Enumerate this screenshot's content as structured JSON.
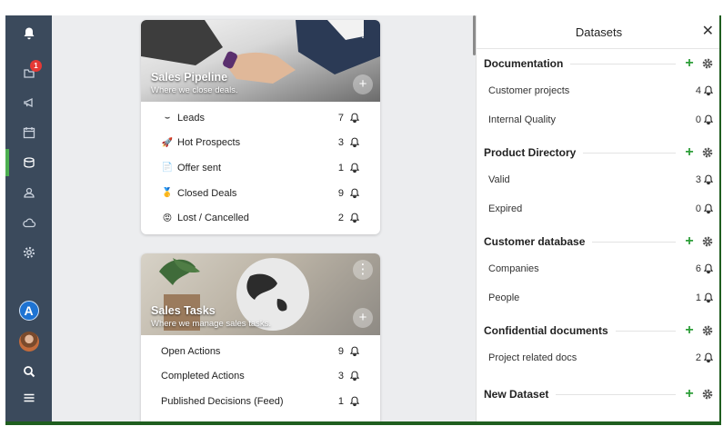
{
  "sidebar": {
    "notifications_badge": "1",
    "profile_initial": "A"
  },
  "cards": [
    {
      "title": "Sales Pipeline",
      "subtitle": "Where we close deals.",
      "rows": [
        {
          "emoji": "⌣",
          "label": "Leads",
          "count": "7"
        },
        {
          "emoji": "🚀",
          "label": "Hot Prospects",
          "count": "3"
        },
        {
          "emoji": "📄",
          "label": "Offer sent",
          "count": "1"
        },
        {
          "emoji": "🥇",
          "label": "Closed Deals",
          "count": "9"
        },
        {
          "emoji": "😡",
          "label": "Lost / Cancelled",
          "count": "2"
        }
      ]
    },
    {
      "title": "Sales Tasks",
      "subtitle": "Where we manage sales tasks.",
      "rows": [
        {
          "emoji": "",
          "label": "Open Actions",
          "count": "9"
        },
        {
          "emoji": "",
          "label": "Completed Actions",
          "count": "3"
        },
        {
          "emoji": "",
          "label": "Published Decisions (Feed)",
          "count": "1"
        }
      ]
    }
  ],
  "panel": {
    "title": "Datasets",
    "close_icon": "✕",
    "sections": [
      {
        "name": "Documentation",
        "items": [
          {
            "label": "Customer projects",
            "count": "4"
          },
          {
            "label": "Internal Quality",
            "count": "0"
          }
        ]
      },
      {
        "name": "Product Directory",
        "items": [
          {
            "label": "Valid",
            "count": "3"
          },
          {
            "label": "Expired",
            "count": "0"
          }
        ]
      },
      {
        "name": "Customer database",
        "items": [
          {
            "label": "Companies",
            "count": "6"
          },
          {
            "label": "People",
            "count": "1"
          }
        ]
      },
      {
        "name": "Confidential documents",
        "items": [
          {
            "label": "Project related docs",
            "count": "2"
          }
        ]
      },
      {
        "name": "New Dataset",
        "items": []
      }
    ]
  },
  "colors": {
    "sidebar_bg": "#3b4a5c",
    "accent_green": "#2e9e3a",
    "badge_red": "#e53935"
  },
  "icons": {
    "sidebar": [
      "bell-icon",
      "inbox-icon",
      "megaphone-icon",
      "calendar-icon",
      "database-icon",
      "users-icon",
      "cloud-icon",
      "gear-icon",
      "search-icon",
      "menu-icon"
    ],
    "row": "bell-icon"
  }
}
